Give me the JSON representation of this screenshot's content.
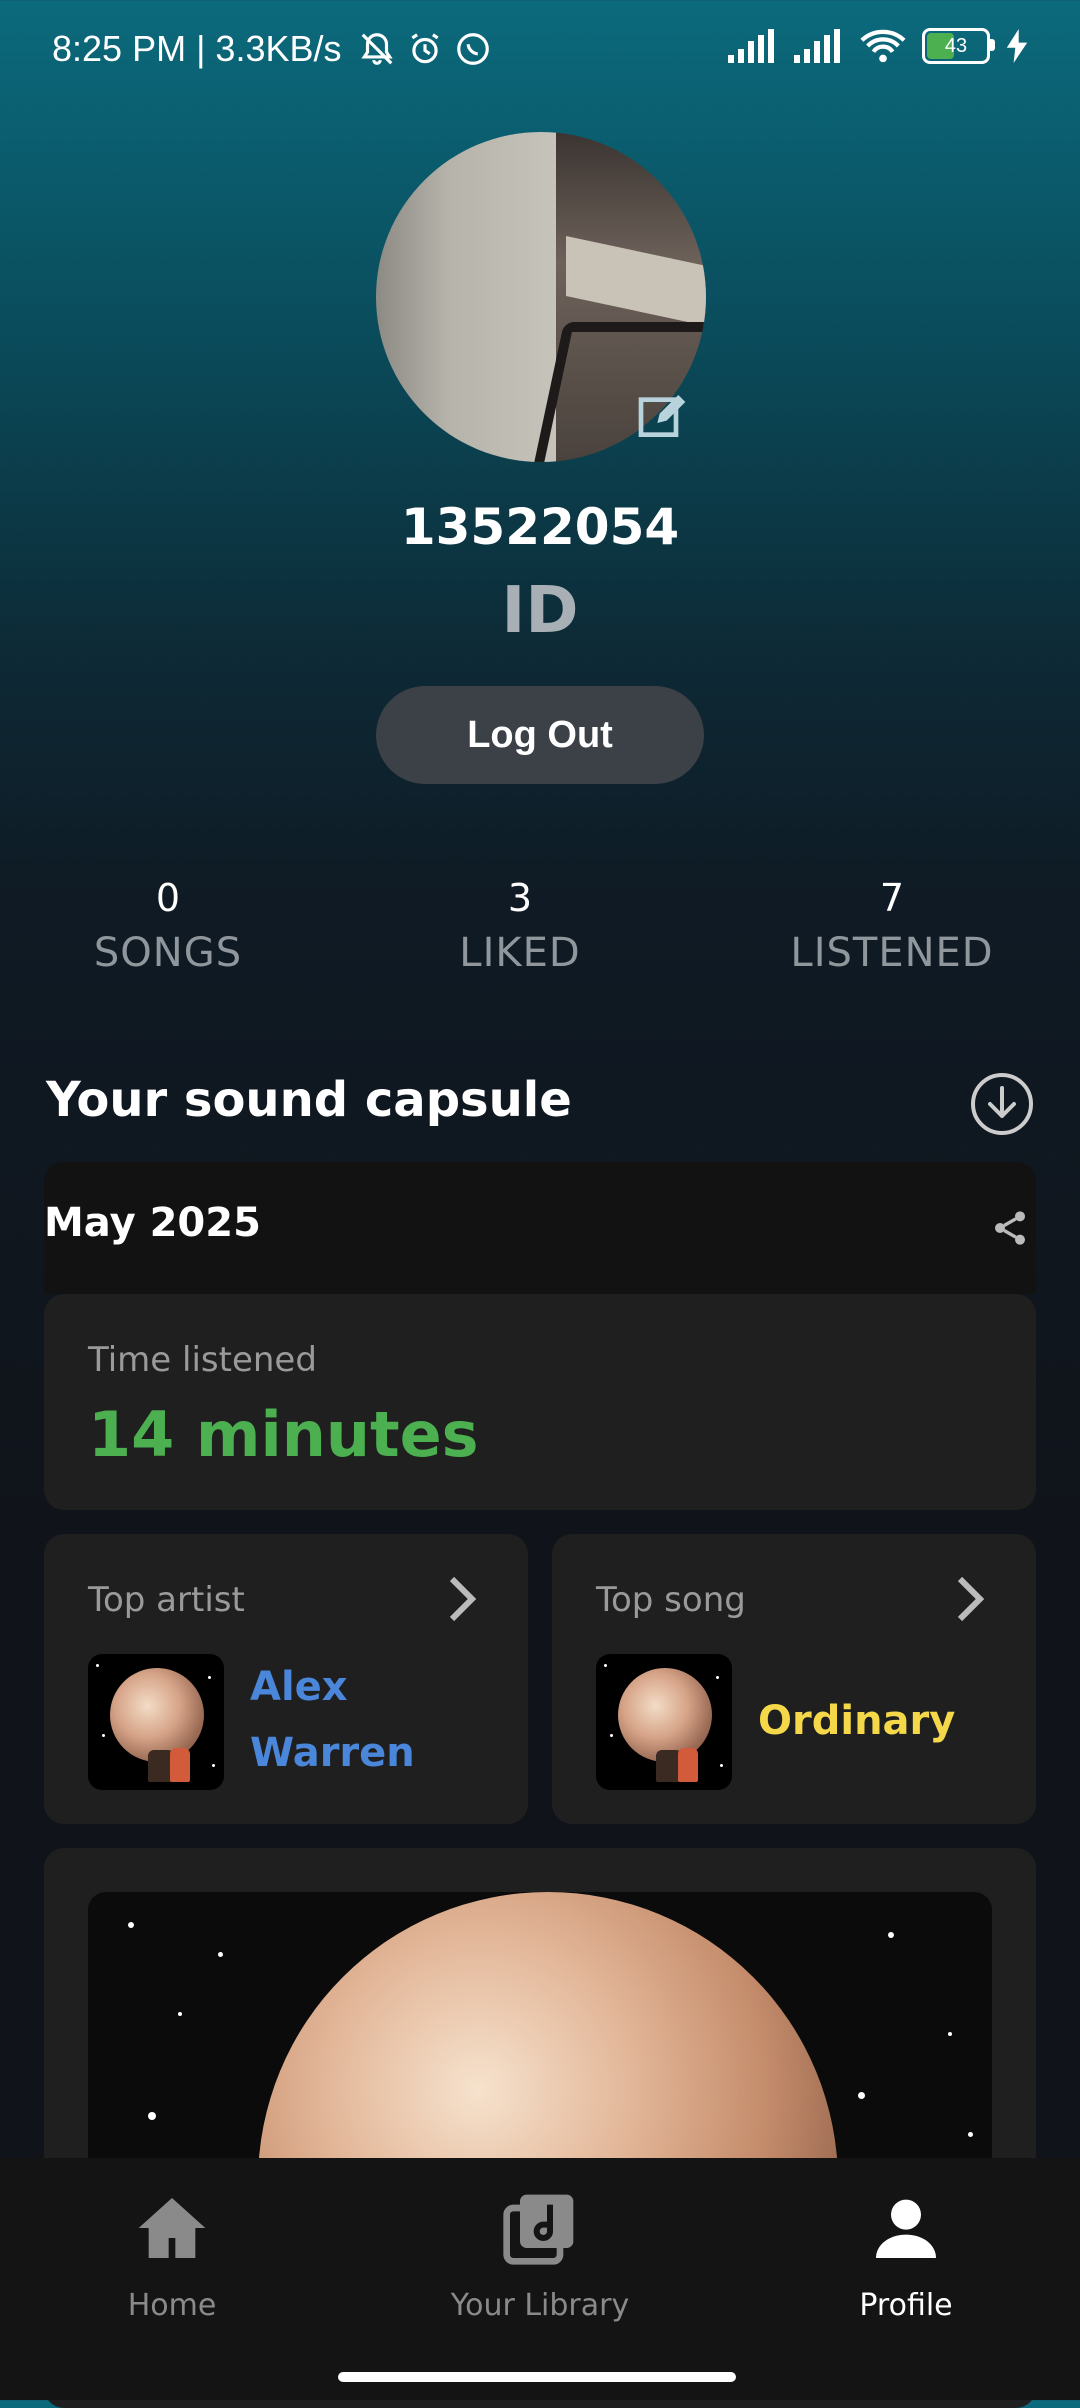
{
  "status_bar": {
    "time_speed": "8:25 PM | 3.3KB/s",
    "battery_level": "43",
    "icons_left": [
      "mute-bell-icon",
      "alarm-icon",
      "whatsapp-icon"
    ],
    "icons_right": [
      "signal-icon",
      "signal-icon",
      "wifi-icon",
      "battery-icon",
      "charging-icon"
    ]
  },
  "profile": {
    "username": "13522054",
    "location": "ID",
    "logout_label": "Log Out"
  },
  "stats": [
    {
      "value": "0",
      "label": "SONGS"
    },
    {
      "value": "3",
      "label": "LIKED"
    },
    {
      "value": "7",
      "label": "LISTENED"
    }
  ],
  "capsule": {
    "title": "Your sound capsule",
    "month": "May 2025",
    "time_listened_label": "Time listened",
    "time_listened_value": "14 minutes",
    "top_artist_label": "Top artist",
    "top_artist_line1": "Alex",
    "top_artist_line2": "Warren",
    "top_song_label": "Top song",
    "top_song": "Ordinary",
    "colors": {
      "time": "#4caf50",
      "artist": "#4a86d9",
      "song": "#f4d84a"
    }
  },
  "nav": {
    "home": "Home",
    "library": "Your Library",
    "profile": "Profile"
  }
}
